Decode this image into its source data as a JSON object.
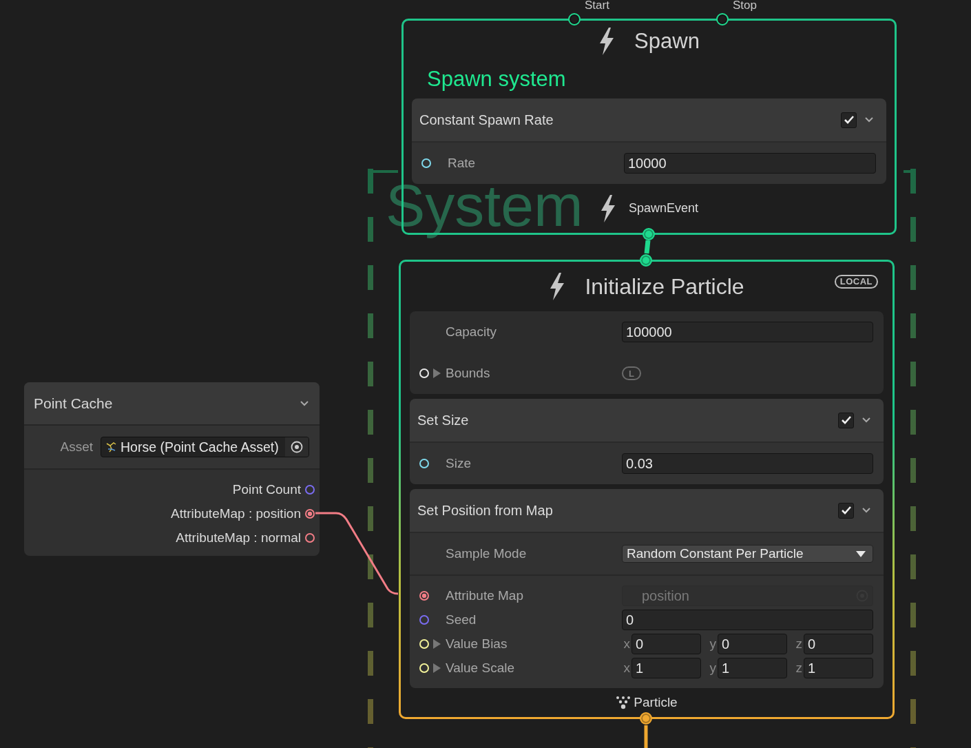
{
  "system": {
    "title": "System"
  },
  "contexts": [
    {
      "kind": "spawn",
      "title": "Spawn",
      "subtitle": "Spawn system",
      "inputs": [
        {
          "label": "Start",
          "connected": false
        },
        {
          "label": "Stop",
          "connected": false
        }
      ],
      "blocks": [
        {
          "title": "Constant Spawn Rate",
          "enabled": true,
          "sections": [
            [
              {
                "kind": "field",
                "label": "Rate",
                "port": {
                  "color": "#7fd9ec",
                  "connected": false
                },
                "value": "10000"
              }
            ]
          ]
        }
      ],
      "output": {
        "label": "SpawnEvent",
        "connected": true
      }
    },
    {
      "kind": "initialize",
      "title": "Initialize Particle",
      "space": "LOCAL",
      "inputs": [
        {
          "connected": true
        }
      ],
      "settings": [
        {
          "kind": "field",
          "label": "Capacity",
          "value": "100000"
        },
        {
          "kind": "bounds",
          "label": "Bounds",
          "port": {
            "color": "#e8e8e8",
            "connected": false
          },
          "expanded": false,
          "space": "L"
        }
      ],
      "blocks": [
        {
          "title": "Set Size",
          "enabled": true,
          "sections": [
            [
              {
                "kind": "field",
                "label": "Size",
                "port": {
                  "color": "#7fd9ec",
                  "connected": false
                },
                "value": "0.03"
              }
            ]
          ]
        },
        {
          "title": "Set Position from Map",
          "enabled": true,
          "sections": [
            [
              {
                "kind": "dropdown",
                "label": "Sample Mode",
                "value": "Random Constant Per Particle"
              }
            ],
            [
              {
                "kind": "object",
                "label": "Attribute Map",
                "port": {
                  "color": "#f27d86",
                  "connected": true
                },
                "value": "position",
                "disabled": true
              },
              {
                "kind": "field",
                "label": "Seed",
                "port": {
                  "color": "#7a6cf0",
                  "connected": false
                },
                "value": "0"
              },
              {
                "kind": "vector3",
                "label": "Value Bias",
                "port": {
                  "color": "#f2f29a",
                  "connected": false
                },
                "expanded": false,
                "axes": [
                  {
                    "axis": "x",
                    "value": "0"
                  },
                  {
                    "axis": "y",
                    "value": "0"
                  },
                  {
                    "axis": "z",
                    "value": "0"
                  }
                ]
              },
              {
                "kind": "vector3",
                "label": "Value Scale",
                "port": {
                  "color": "#f2f29a",
                  "connected": false
                },
                "expanded": false,
                "axes": [
                  {
                    "axis": "x",
                    "value": "1"
                  },
                  {
                    "axis": "y",
                    "value": "1"
                  },
                  {
                    "axis": "z",
                    "value": "1"
                  }
                ]
              }
            ]
          ]
        }
      ],
      "output": {
        "label": "Particle",
        "connected": true
      }
    }
  ],
  "operator": {
    "title": "Point Cache",
    "settings": [
      {
        "kind": "object",
        "label": "Asset",
        "value": "Horse (Point Cache Asset)"
      }
    ],
    "outputs": [
      {
        "label": "Point Count",
        "color": "#7a6cf0",
        "connected": false
      },
      {
        "label": "AttributeMap : position",
        "color": "#f27d86",
        "connected": true
      },
      {
        "label": "AttributeMap : normal",
        "color": "#f27d86",
        "connected": false
      }
    ]
  }
}
